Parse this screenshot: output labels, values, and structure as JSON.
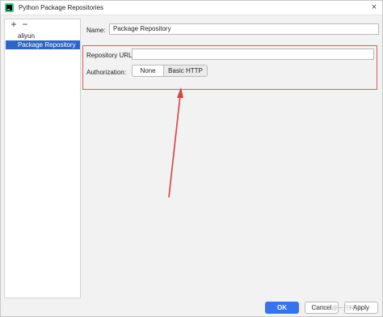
{
  "window": {
    "title": "Python Package Repositories",
    "close_glyph": "×"
  },
  "sidebar": {
    "add_glyph": "+",
    "remove_glyph": "−",
    "items": [
      {
        "label": "aliyun",
        "selected": false
      },
      {
        "label": "Package Repository",
        "selected": true
      }
    ]
  },
  "form": {
    "name_label": "Name:",
    "name_value": "Package Repository",
    "url_label": "Repository URL:",
    "url_value": "",
    "auth_label": "Authorization:",
    "auth_options": [
      "None",
      "Basic HTTP"
    ],
    "auth_selected": "None"
  },
  "footer": {
    "ok_label": "OK",
    "cancel_label": "Cancel",
    "apply_label": "Apply",
    "watermark": "CSDN @一只科技"
  },
  "colors": {
    "accent": "#3574f0",
    "selection": "#2f65ca",
    "highlight_box": "#e05a5a",
    "arrow": "#d94040"
  },
  "icons": {
    "app": "pycharm-icon",
    "close": "close-icon",
    "add": "plus-icon",
    "remove": "minus-icon"
  }
}
